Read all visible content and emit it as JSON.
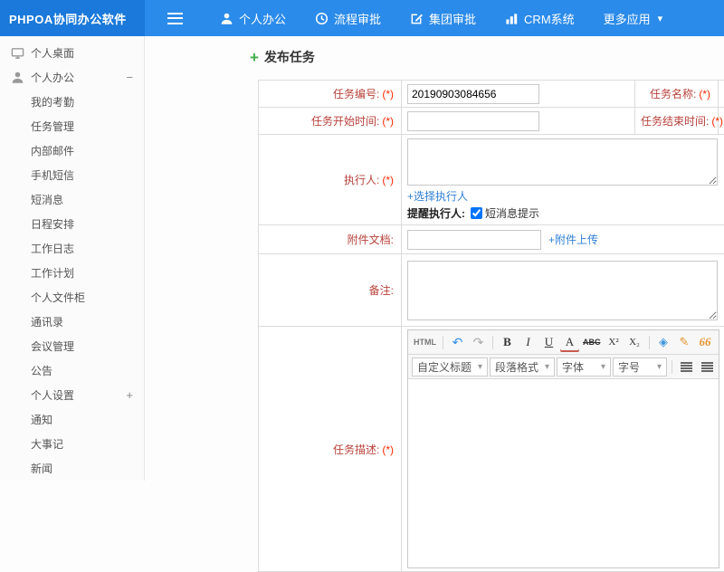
{
  "colors": {
    "navbar_blue": "#2b8bea",
    "logo_blue": "#1a79da",
    "link_blue": "#2e7fd6",
    "label_red": "#b8413b",
    "required_red": "#f42a00",
    "plus_green": "#3fae49"
  },
  "navbar": {
    "logo": "PHPOA协同办公软件",
    "items": [
      {
        "label": "个人办公"
      },
      {
        "label": "流程审批"
      },
      {
        "label": "集团审批"
      },
      {
        "label": "CRM系统"
      },
      {
        "label": "更多应用",
        "caret": "▾"
      }
    ]
  },
  "sidebar": {
    "items": [
      {
        "label": "个人桌面"
      },
      {
        "label": "个人办公",
        "toggle": "−"
      },
      {
        "label": "我的考勤"
      },
      {
        "label": "任务管理"
      },
      {
        "label": "内部邮件"
      },
      {
        "label": "手机短信"
      },
      {
        "label": "短消息"
      },
      {
        "label": "日程安排"
      },
      {
        "label": "工作日志"
      },
      {
        "label": "工作计划"
      },
      {
        "label": "个人文件柜"
      },
      {
        "label": "通讯录"
      },
      {
        "label": "会议管理"
      },
      {
        "label": "公告"
      },
      {
        "label": "个人设置",
        "toggle": "+"
      },
      {
        "label": "通知"
      },
      {
        "label": "大事记"
      },
      {
        "label": "新闻"
      }
    ]
  },
  "main": {
    "title": "发布任务",
    "title_icon": "+"
  },
  "form": {
    "task_number": {
      "label": "任务编号:",
      "required": "(*)",
      "value": "20190903084656"
    },
    "task_name": {
      "label": "任务名称:",
      "required": "(*)",
      "value": ""
    },
    "start_time": {
      "label": "任务开始时间:",
      "required": "(*)",
      "value": ""
    },
    "end_time": {
      "label": "任务结束时间:",
      "required": "(*)",
      "value": ""
    },
    "executor": {
      "label": "执行人:",
      "required": "(*)",
      "value": "",
      "select_link": "+选择执行人",
      "remind_label": "提醒执行人:",
      "remind_option": "短消息提示",
      "remind_checked": true
    },
    "attachment": {
      "label": "附件文档:",
      "value": "",
      "upload_link": "+附件上传"
    },
    "remark": {
      "label": "备注:",
      "value": ""
    },
    "description": {
      "label": "任务描述:",
      "required": "(*)"
    }
  },
  "editor": {
    "select_caret": "▾",
    "toolbar": [
      {
        "name": "html-source",
        "glyph": "HTML"
      },
      {
        "name": "undo",
        "glyph": "↶"
      },
      {
        "name": "redo",
        "glyph": "↷"
      },
      {
        "name": "bold",
        "glyph": "B"
      },
      {
        "name": "italic",
        "glyph": "I"
      },
      {
        "name": "underline",
        "glyph": "U"
      },
      {
        "name": "font",
        "glyph": "A"
      },
      {
        "name": "strikethrough",
        "glyph": "ABC"
      },
      {
        "name": "superscript",
        "glyph": "X²"
      },
      {
        "name": "subscript",
        "glyph": "X₂"
      },
      {
        "name": "remove-format",
        "glyph": "◈"
      },
      {
        "name": "format-painter",
        "glyph": "✎"
      },
      {
        "name": "blockquote",
        "glyph": "66"
      },
      {
        "name": "font-color",
        "glyph": "A",
        "caret": "▾"
      }
    ],
    "selects": [
      {
        "label": "自定义标题"
      },
      {
        "label": "段落格式"
      },
      {
        "label": "字体"
      },
      {
        "label": "字号"
      }
    ],
    "align_buttons": [
      "align-left",
      "align-center",
      "align-right",
      "align-justify"
    ]
  }
}
